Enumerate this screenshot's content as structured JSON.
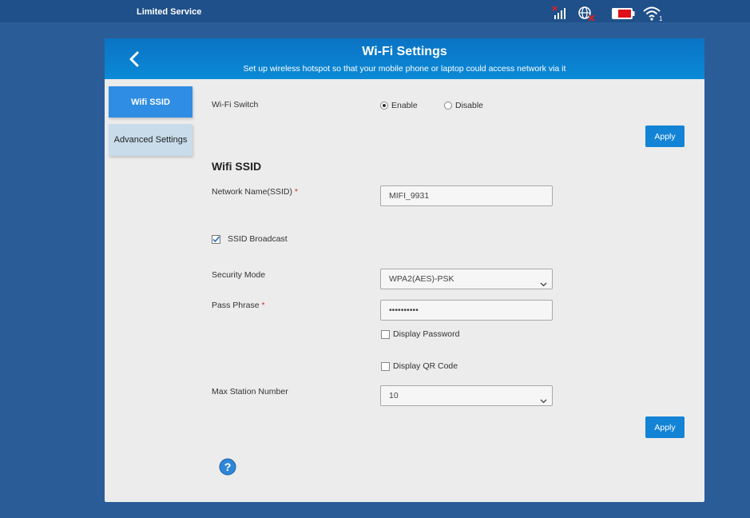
{
  "status_bar": {
    "service_text": "Limited Service",
    "icons": [
      "signal-no-sim-icon",
      "globe-disconnected-icon",
      "battery-low-icon",
      "wifi-clients-icon"
    ],
    "wifi_client_count": "1",
    "colors": {
      "bar": "#1f5089",
      "alert": "#e02020"
    }
  },
  "header": {
    "title": "Wi-Fi Settings",
    "subtitle": "Set up wireless hotspot so that your mobile phone or laptop could access network via it"
  },
  "sidebar": {
    "items": [
      {
        "label": "Wifi SSID",
        "active": true
      },
      {
        "label": "Advanced Settings",
        "active": false
      }
    ]
  },
  "wifi_switch": {
    "label": "Wi-Fi Switch",
    "options": [
      "Enable",
      "Disable"
    ],
    "selected": "Enable",
    "apply_label": "Apply"
  },
  "ssid_section": {
    "title": "Wifi SSID",
    "network_name_label": "Network Name(SSID)",
    "network_name_value": "MIFI_9931",
    "required_mark": "*",
    "ssid_broadcast_label": "SSID Broadcast",
    "ssid_broadcast_checked": true,
    "security_mode_label": "Security Mode",
    "security_mode_value": "WPA2(AES)-PSK",
    "pass_phrase_label": "Pass Phrase",
    "pass_phrase_value": "••••••••••",
    "display_password_label": "Display Password",
    "display_qr_label": "Display QR Code",
    "max_station_label": "Max Station Number",
    "max_station_value": "10",
    "apply_label": "Apply"
  },
  "colors": {
    "accent": "#1383d6",
    "header": "#0b7fcd",
    "sidebar_inactive": "#c8dcea",
    "page_bg": "#2a5d97"
  }
}
